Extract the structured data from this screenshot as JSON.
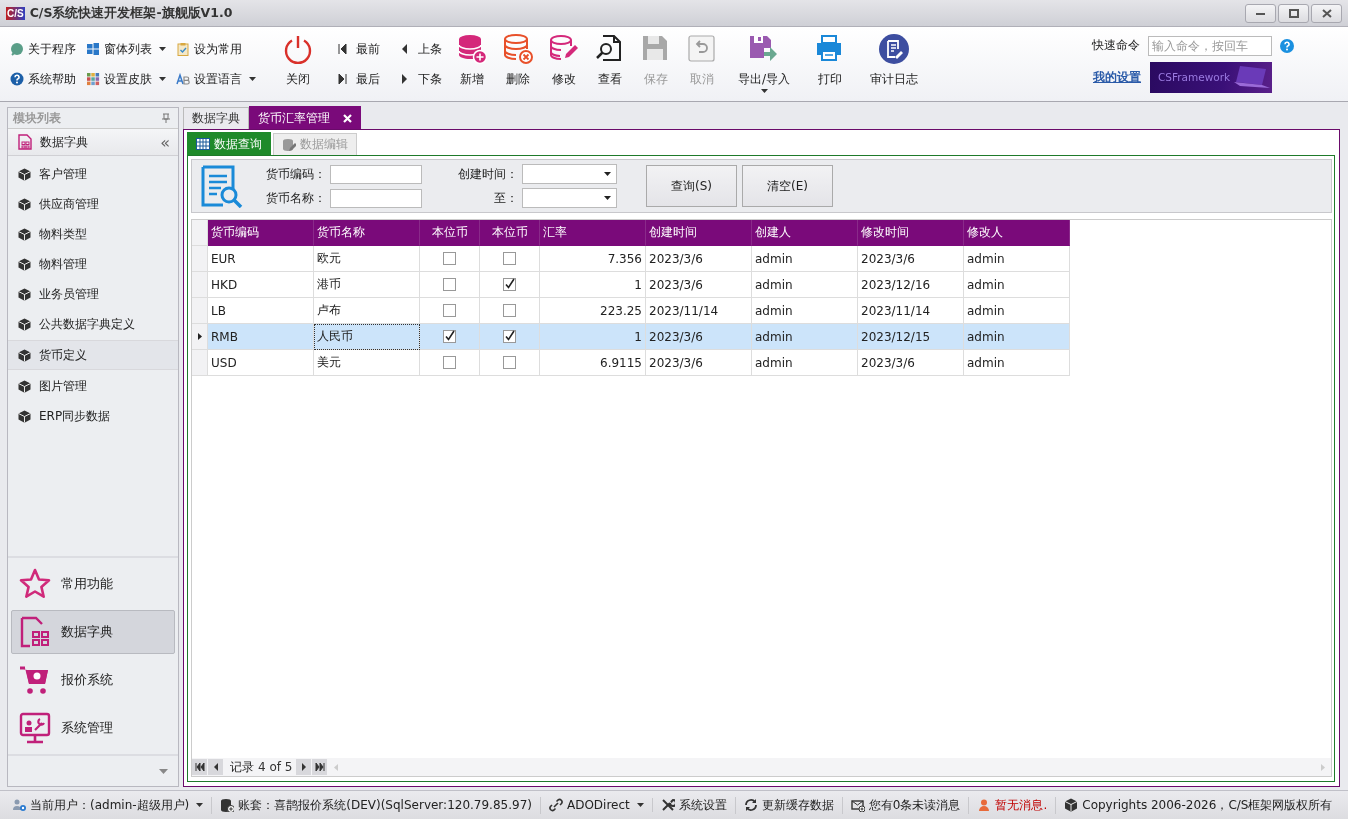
{
  "window": {
    "title": "C/S系统快速开发框架-旗舰版V1.0",
    "logo": "C/S"
  },
  "ribbon": {
    "small_buttons": [
      {
        "label": "关于程序",
        "dropdown": false
      },
      {
        "label": "系统帮助",
        "dropdown": false
      },
      {
        "label": "窗体列表",
        "dropdown": true
      },
      {
        "label": "设置皮肤",
        "dropdown": true
      },
      {
        "label": "设为常用",
        "dropdown": false
      },
      {
        "label": "设置语言",
        "dropdown": true
      }
    ],
    "close_button": {
      "label": "关闭"
    },
    "nav_buttons": [
      {
        "label": "最前"
      },
      {
        "label": "最后"
      },
      {
        "label": "上条"
      },
      {
        "label": "下条"
      }
    ],
    "large_buttons": [
      {
        "label": "新增",
        "disabled": false,
        "dropdown": false
      },
      {
        "label": "删除",
        "disabled": false,
        "dropdown": false
      },
      {
        "label": "修改",
        "disabled": false,
        "dropdown": false
      },
      {
        "label": "查看",
        "disabled": false,
        "dropdown": false
      },
      {
        "label": "保存",
        "disabled": true,
        "dropdown": false
      },
      {
        "label": "取消",
        "disabled": true,
        "dropdown": false
      },
      {
        "label": "导出/导入",
        "disabled": false,
        "dropdown": true
      },
      {
        "label": "打印",
        "disabled": false,
        "dropdown": false
      },
      {
        "label": "审计日志",
        "disabled": false,
        "dropdown": false
      }
    ],
    "quick_command": {
      "label": "快速命令",
      "placeholder": "输入命令，按回车"
    },
    "settings_link": "我的设置",
    "banner": "CSFramework"
  },
  "sidebar": {
    "title": "模块列表",
    "group": "数据字典",
    "collapse": "«",
    "items": [
      {
        "label": "客户管理",
        "selected": false
      },
      {
        "label": "供应商管理",
        "selected": false
      },
      {
        "label": "物料类型",
        "selected": false
      },
      {
        "label": "物料管理",
        "selected": false
      },
      {
        "label": "业务员管理",
        "selected": false
      },
      {
        "label": "公共数据字典定义",
        "selected": false
      },
      {
        "label": "货币定义",
        "selected": true
      },
      {
        "label": "图片管理",
        "selected": false
      },
      {
        "label": "ERP同步数据",
        "selected": false
      }
    ],
    "nav": [
      {
        "label": "常用功能",
        "selected": false
      },
      {
        "label": "数据字典",
        "selected": true
      },
      {
        "label": "报价系统",
        "selected": false
      },
      {
        "label": "系统管理",
        "selected": false
      }
    ]
  },
  "doc_tabs": [
    {
      "label": "数据字典",
      "selected": false,
      "closable": false
    },
    {
      "label": "货币汇率管理",
      "selected": true,
      "closable": true
    }
  ],
  "sub_tabs": [
    {
      "label": "数据查询",
      "selected": true,
      "disabled": false
    },
    {
      "label": "数据编辑",
      "selected": false,
      "disabled": true
    }
  ],
  "search": {
    "fields": [
      {
        "label": "货币编码：",
        "kind": "text"
      },
      {
        "label": "货币名称：",
        "kind": "text"
      }
    ],
    "dates": [
      {
        "label": "创建时间：",
        "kind": "date"
      },
      {
        "label": "至：",
        "kind": "date"
      }
    ],
    "buttons": [
      "查询(S)",
      "清空(E)"
    ]
  },
  "table": {
    "columns": [
      "货币编码",
      "货币名称",
      "本位币",
      "本位币",
      "汇率",
      "创建时间",
      "创建人",
      "修改时间",
      "修改人"
    ],
    "rows": [
      {
        "selected": false,
        "code": "EUR",
        "name": "欧元",
        "base1": false,
        "base2": false,
        "rate": "7.356",
        "created": "2023/3/6",
        "creator": "admin",
        "modified": "2023/3/6",
        "modifier": "admin"
      },
      {
        "selected": false,
        "code": "HKD",
        "name": "港币",
        "base1": false,
        "base2": true,
        "rate": "1",
        "created": "2023/3/6",
        "creator": "admin",
        "modified": "2023/12/16",
        "modifier": "admin"
      },
      {
        "selected": false,
        "code": "LB",
        "name": "卢布",
        "base1": false,
        "base2": false,
        "rate": "223.25",
        "created": "2023/11/14",
        "creator": "admin",
        "modified": "2023/11/14",
        "modifier": "admin"
      },
      {
        "selected": true,
        "code": "RMB",
        "name": "人民币",
        "base1": true,
        "base2": true,
        "rate": "1",
        "created": "2023/3/6",
        "creator": "admin",
        "modified": "2023/12/15",
        "modifier": "admin"
      },
      {
        "selected": false,
        "code": "USD",
        "name": "美元",
        "base1": false,
        "base2": false,
        "rate": "6.9115",
        "created": "2023/3/6",
        "creator": "admin",
        "modified": "2023/3/6",
        "modifier": "admin"
      }
    ]
  },
  "pager": {
    "label": "记录",
    "position": "4 of 5"
  },
  "status_bar": [
    {
      "text": "当前用户：(admin-超级用户)",
      "dropdown": true,
      "alert": false
    },
    {
      "text": "账套：喜鹊报价系统(DEV)(SqlServer:120.79.85.97)",
      "dropdown": false,
      "alert": false
    },
    {
      "text": "ADODirect",
      "dropdown": true,
      "alert": false
    },
    {
      "text": "系统设置",
      "dropdown": false,
      "alert": false
    },
    {
      "text": "更新缓存数据",
      "dropdown": false,
      "alert": false
    },
    {
      "text": "您有0条未读消息",
      "dropdown": false,
      "alert": false
    },
    {
      "text": "暂无消息.",
      "dropdown": false,
      "alert": true
    },
    {
      "text": "Copyrights 2006-2026，C/S框架网版权所有",
      "dropdown": false,
      "alert": false
    }
  ]
}
